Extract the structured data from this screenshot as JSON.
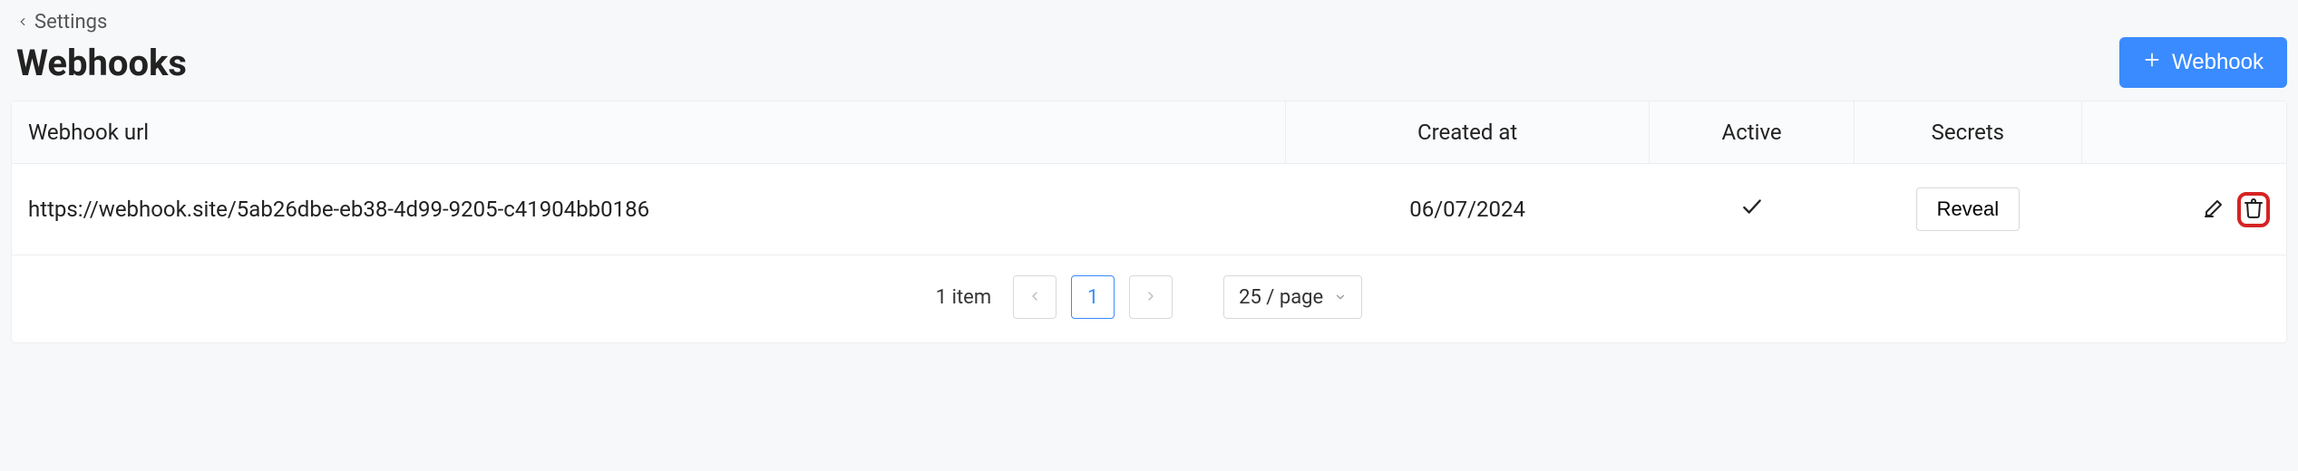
{
  "breadcrumb": {
    "back_label": "Settings"
  },
  "header": {
    "title": "Webhooks",
    "add_button_label": "Webhook"
  },
  "table": {
    "columns": {
      "url": "Webhook url",
      "created_at": "Created at",
      "active": "Active",
      "secrets": "Secrets"
    },
    "rows": [
      {
        "url": "https://webhook.site/5ab26dbe-eb38-4d99-9205-c41904bb0186",
        "created_at": "06/07/2024",
        "active": true,
        "reveal_label": "Reveal"
      }
    ]
  },
  "pagination": {
    "count_label": "1 item",
    "current_page": "1",
    "page_size_label": "25 / page"
  }
}
